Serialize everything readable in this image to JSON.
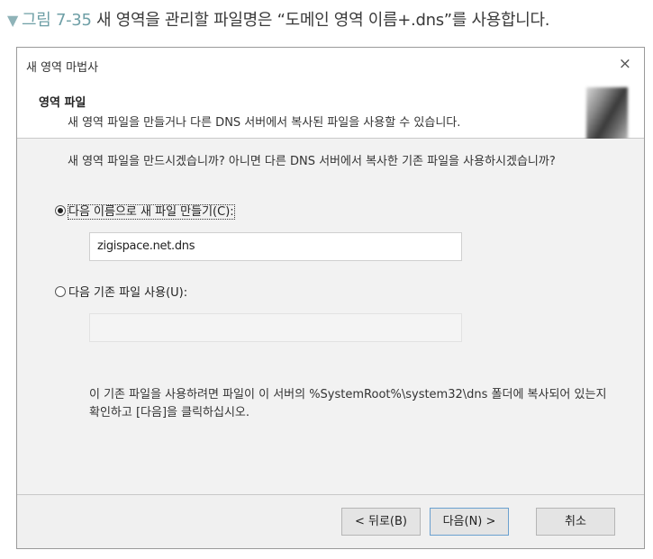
{
  "caption": {
    "figure": "그림 7-35",
    "text": "새 영역을 관리할 파일명은 “도메인 영역 이름+.dns”를 사용합니다."
  },
  "window": {
    "title": "새 영역 마법사",
    "close_glyph": "×"
  },
  "header": {
    "title": "영역 파일",
    "subtitle": "새 영역 파일을 만들거나 다른 DNS 서버에서 복사된 파일을 사용할 수 있습니다."
  },
  "content": {
    "prompt": "새 영역 파일을 만드시겠습니까? 아니면 다른 DNS 서버에서 복사한 기존 파일을 사용하시겠습니까?",
    "option_new_label": "다음 이름으로 새 파일 만들기(C):",
    "option_new_selected": true,
    "new_file_value": "zigispace.net.dns",
    "option_existing_label": "다음 기존 파일 사용(U):",
    "existing_file_value": "",
    "note": "이 기존 파일을 사용하려면 파일이 이 서버의 %SystemRoot%\\system32\\dns 폴더에 복사되어 있는지 확인하고 [다음]을 클릭하십시오."
  },
  "buttons": {
    "back": "< 뒤로(B)",
    "next": "다음(N) >",
    "cancel": "취소"
  }
}
